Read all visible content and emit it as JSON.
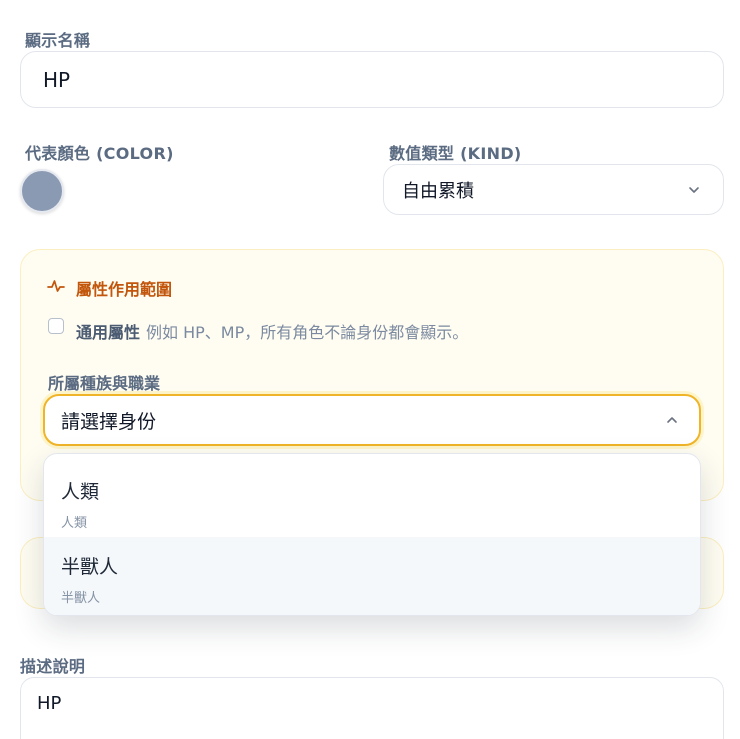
{
  "display_name": {
    "label": "顯示名稱",
    "value": "HP"
  },
  "color": {
    "label": "代表顏色 (COLOR)",
    "value": "#8b9ab3"
  },
  "kind": {
    "label": "數值類型 (KIND)",
    "selected": "自由累積",
    "icon": "chevron-down-icon"
  },
  "scope": {
    "title": "屬性作用範圍",
    "icon": "pulse-icon",
    "accent": "#c2560c",
    "universal_label": "通用屬性",
    "universal_hint": "例如 HP、MP，所有角色不論身份都會顯示。",
    "universal_checked": false,
    "identity_label": "所屬種族與職業",
    "identity_placeholder": "請選擇身份",
    "identity_icon": "chevron-up-icon",
    "options": [
      {
        "label": "人類",
        "sub": "人類"
      },
      {
        "label": "半獸人",
        "sub": "半獸人"
      }
    ]
  },
  "description": {
    "label": "描述說明",
    "value": "HP"
  }
}
